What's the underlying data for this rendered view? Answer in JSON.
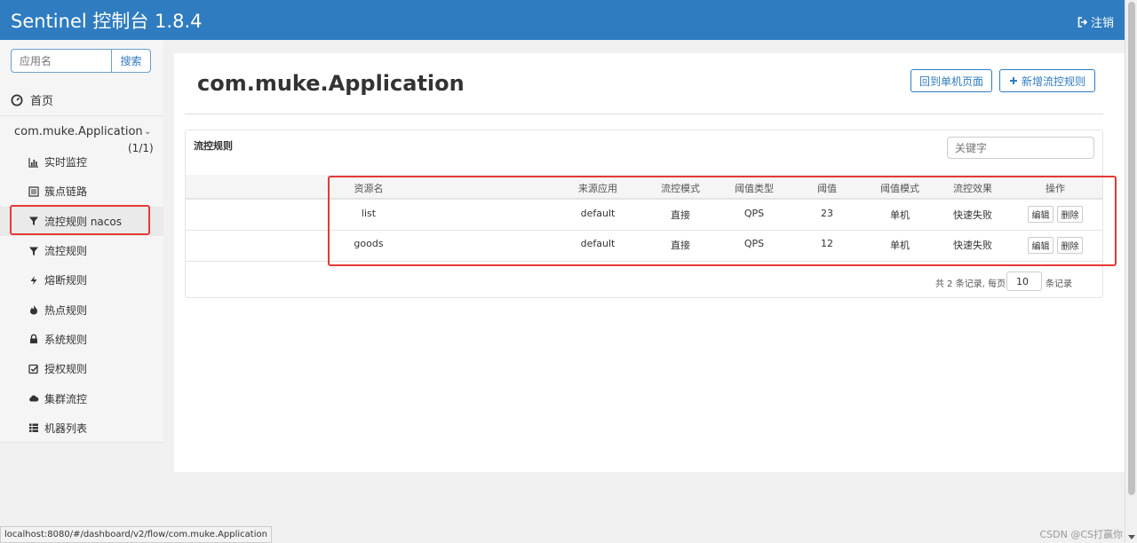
{
  "header": {
    "brand": "Sentinel 控制台 1.8.4",
    "logout": "注销"
  },
  "sidebar": {
    "search_placeholder": "应用名",
    "search_button": "搜索",
    "home": "首页",
    "app_name": "com.muke.Application",
    "app_count": "(1/1)",
    "items": [
      {
        "label": "实时监控",
        "icon": "bar-chart-icon"
      },
      {
        "label": "簇点链路",
        "icon": "list-icon"
      },
      {
        "label": "流控规则 nacos",
        "icon": "filter-icon"
      },
      {
        "label": "流控规则",
        "icon": "filter-icon"
      },
      {
        "label": "熔断规则",
        "icon": "flash-icon"
      },
      {
        "label": "热点规则",
        "icon": "fire-icon"
      },
      {
        "label": "系统规则",
        "icon": "lock-icon"
      },
      {
        "label": "授权规则",
        "icon": "check-square-icon"
      },
      {
        "label": "集群流控",
        "icon": "cloud-icon"
      },
      {
        "label": "机器列表",
        "icon": "th-list-icon"
      }
    ]
  },
  "main": {
    "title": "com.muke.Application",
    "back_button": "回到单机页面",
    "add_button": "新增流控规则",
    "panel_title": "流控规则",
    "keyword_placeholder": "关键字",
    "table": {
      "headers": [
        "资源名",
        "来源应用",
        "流控模式",
        "阈值类型",
        "阈值",
        "阈值模式",
        "流控效果",
        "操作"
      ],
      "rows": [
        {
          "resource": "list",
          "origin": "default",
          "mode": "直接",
          "grade": "QPS",
          "count": "23",
          "cluster": "单机",
          "effect": "快速失败"
        },
        {
          "resource": "goods",
          "origin": "default",
          "mode": "直接",
          "grade": "QPS",
          "count": "12",
          "cluster": "单机",
          "effect": "快速失败"
        }
      ],
      "edit_label": "编辑",
      "delete_label": "删除"
    },
    "pager": {
      "prefix": "共 2 条记录, 每页",
      "page_size": "10",
      "suffix": "条记录"
    }
  },
  "status_bar": "localhost:8080/#/dashboard/v2/flow/com.muke.Application",
  "watermark": "CSDN @CS打赢你",
  "colors": {
    "header": "#2f7cc0",
    "accent": "#2f7cc0",
    "highlight": "#e53935"
  }
}
